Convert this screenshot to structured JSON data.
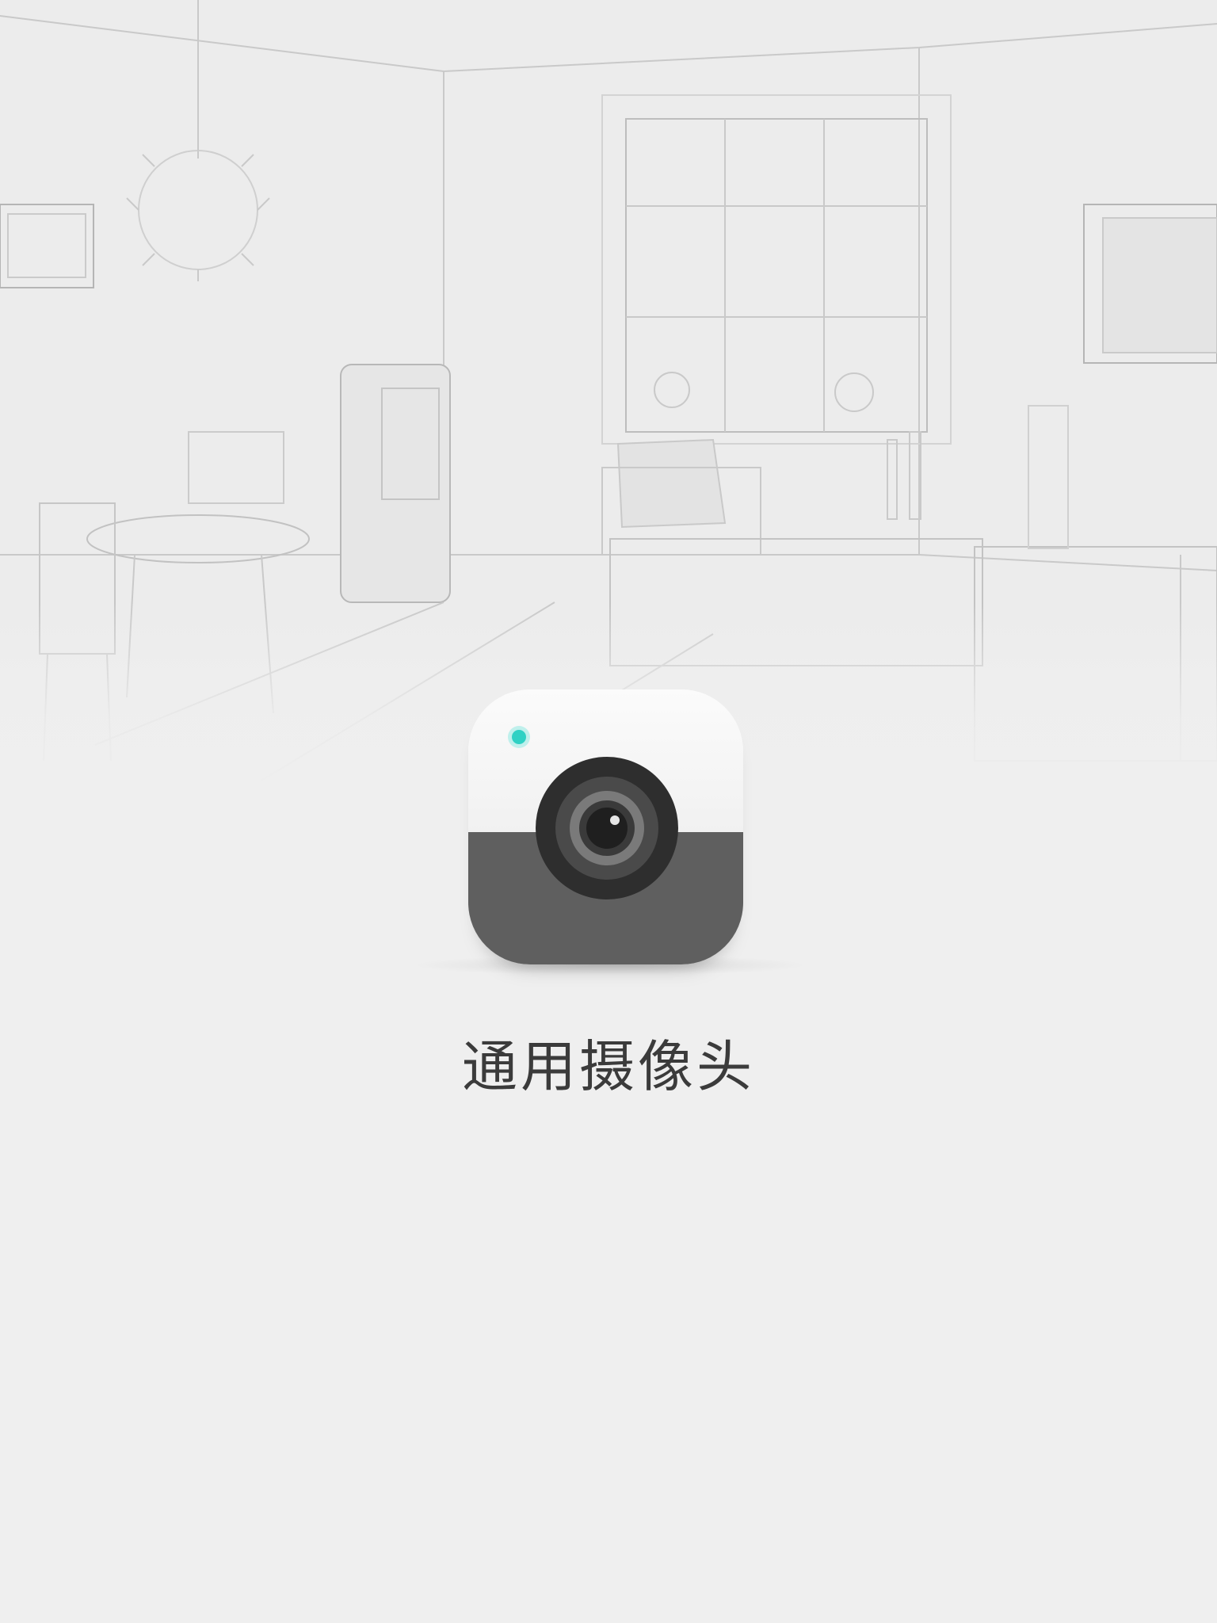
{
  "splash": {
    "app_name": "通用摄像头",
    "icon": {
      "name": "camera-icon",
      "top_color": "#f7f7f7",
      "bottom_color": "#5f5f5f",
      "lens_outer_color": "#2e2e2e",
      "lens_ring_color": "#6b6b6b",
      "indicator_color": "#2fd1c4"
    },
    "background": {
      "name": "room-sketch-illustration",
      "color": "#efefef"
    }
  }
}
